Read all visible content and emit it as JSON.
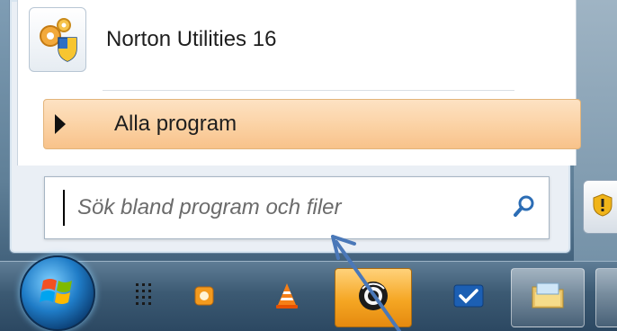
{
  "start_menu": {
    "pinned_program": {
      "label": "Norton Utilities 16",
      "icon": "norton-utilities-icon"
    },
    "all_programs": {
      "label": "Alla program",
      "icon": "arrow-right-icon"
    },
    "search": {
      "placeholder": "Sök bland program och filer",
      "value": "",
      "icon": "search-icon"
    }
  },
  "side_panel": {
    "icon": "shield-warning-icon"
  },
  "taskbar": {
    "start_button": {
      "icon": "windows-orb-icon"
    },
    "items": [
      {
        "icon": "dots-grid-icon",
        "state": "normal"
      },
      {
        "icon": "media-player-icon",
        "state": "normal"
      },
      {
        "icon": "vlc-cone-icon",
        "state": "normal"
      },
      {
        "icon": "chrome-like-icon",
        "state": "active"
      },
      {
        "icon": "checkmark-app-icon",
        "state": "normal"
      },
      {
        "icon": "folder-icon",
        "state": "framed"
      }
    ]
  },
  "colors": {
    "highlight": "#fbd3a6",
    "active_task": "#f5a623",
    "annotation_arrow": "#4a78b8"
  }
}
